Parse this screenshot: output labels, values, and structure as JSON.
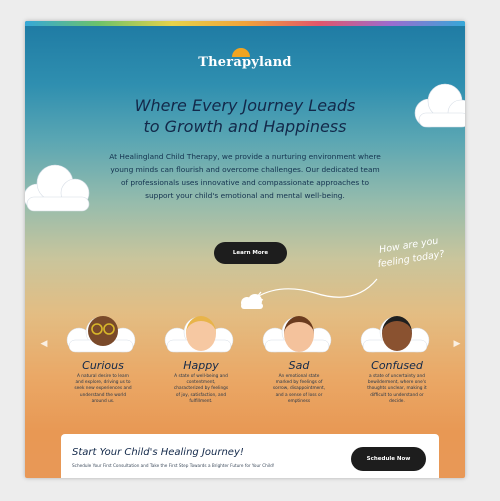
{
  "brand": {
    "name": "Therapyland",
    "accent": "#f2a420"
  },
  "hero": {
    "headline_line1": "Where Every Journey Leads",
    "headline_line2": "to Growth and Happiness",
    "intro_line1": "At Healingland Child Therapy, we provide a nurturing environment where",
    "intro_line2": "young minds can flourish and overcome challenges. Our dedicated team",
    "intro_line3": "of professionals uses innovative and compassionate approaches to",
    "intro_line4": "support your child's emotional and mental well-being.",
    "learn_more_label": "Learn More",
    "handnote_line1": "How are you",
    "handnote_line2": "feeling today?"
  },
  "emotions": [
    {
      "name": "Curious",
      "d1": "A natural desire to learn",
      "d2": "and explore, driving us to",
      "d3": "seek new experiences and",
      "d4": "understand the world",
      "d5": "around us."
    },
    {
      "name": "Happy",
      "d1": "A state of well-being and",
      "d2": "contentment,",
      "d3": "characterized by feelings",
      "d4": "of joy, satisfaction, and",
      "d5": "fulfillment."
    },
    {
      "name": "Sad",
      "d1": "An emotional state",
      "d2": "marked by feelings of",
      "d3": "sorrow, disappointment,",
      "d4": "and a sense of loss or",
      "d5": "emptiness"
    },
    {
      "name": "Confused",
      "d1": "a state of uncertainty and",
      "d2": "bewilderment, where one's",
      "d3": "thoughts unclear, making it",
      "d4": "difficult to understand or",
      "d5": "decide."
    }
  ],
  "carousel": {
    "prev_icon": "chevron-left-icon",
    "next_icon": "chevron-right-icon"
  },
  "cta": {
    "title": "Start Your Child's Healing Journey!",
    "subtitle": "Schedule Your First Consultation and Take the First Step Towards a Brighter Future for Your Child!",
    "button_label": "Schedule Now"
  }
}
